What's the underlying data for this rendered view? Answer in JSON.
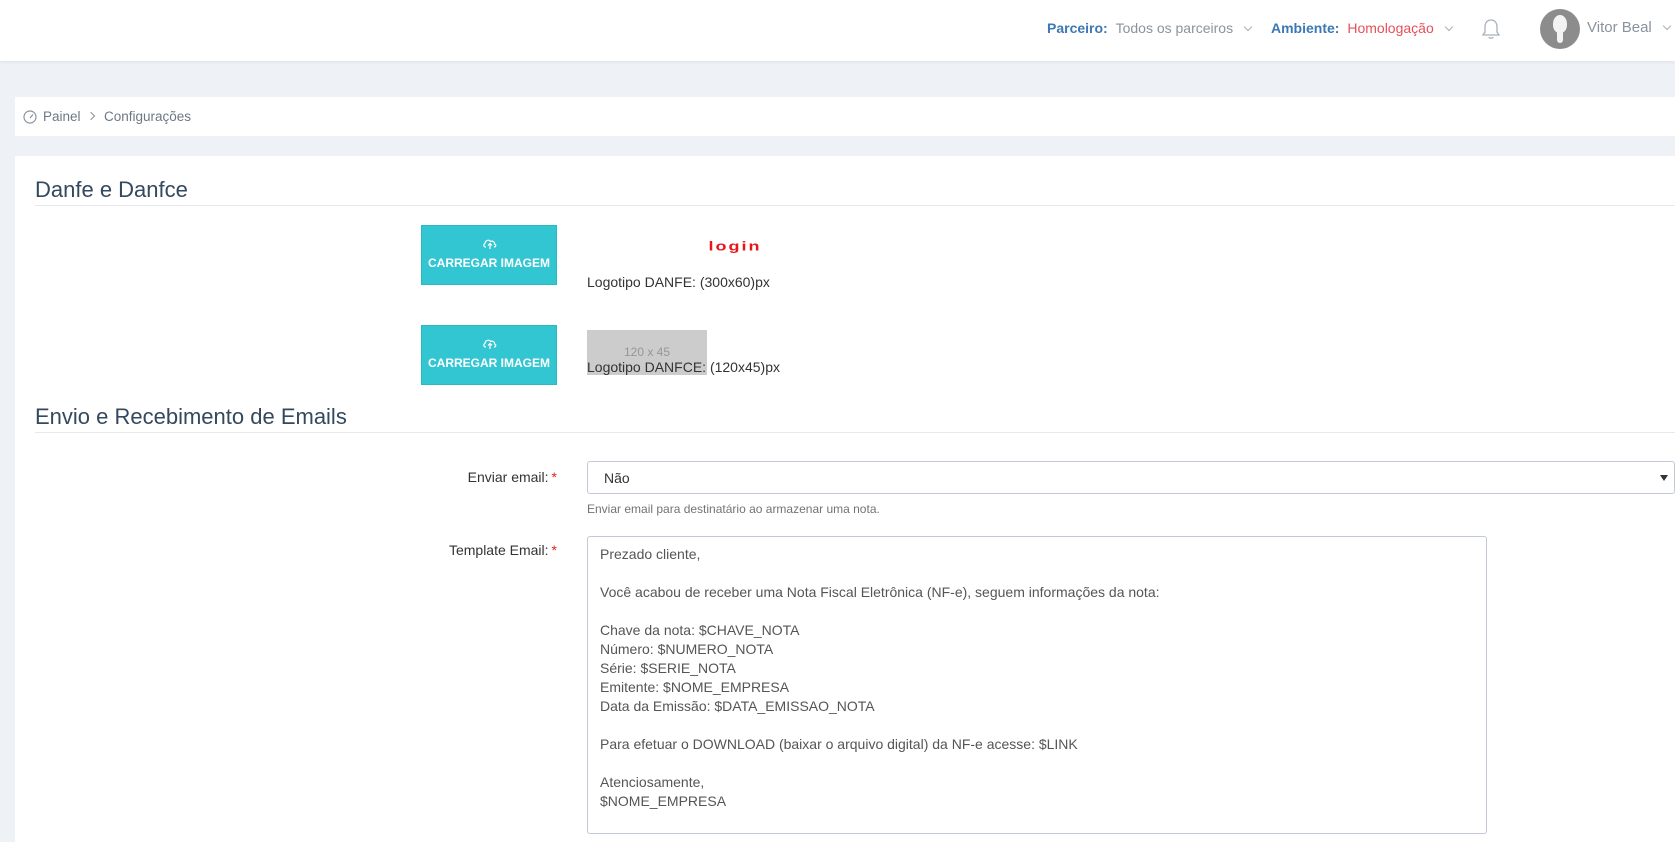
{
  "header": {
    "partner_label": "Parceiro:",
    "partner_value": "Todos os parceiros",
    "env_label": "Ambiente:",
    "env_value": "Homologação",
    "user_name": "Vitor Beal",
    "env_color": "#e7505a",
    "label_color": "#3c78b4"
  },
  "breadcrumb": {
    "items": [
      "Painel",
      "Configurações"
    ]
  },
  "sections": {
    "danfe": {
      "title": "Danfe e Danfce",
      "upload_label": "CARREGAR IMAGEM",
      "logo_text": "login",
      "danfe_caption": "Logotipo DANFE: (300x60)px",
      "danfce_placeholder": "120 x 45",
      "danfce_caption": "Logotipo DANFCE: (120x45)px"
    },
    "email": {
      "title": "Envio e Recebimento de Emails",
      "send_label": "Enviar email:",
      "send_value": "Não",
      "send_help": "Enviar email para destinatário ao armazenar uma nota.",
      "template_label": "Template Email:",
      "template_value": "Prezado cliente,\n\nVocê acabou de receber uma Nota Fiscal Eletrônica (NF-e), seguem informações da nota:\n\nChave da nota: $CHAVE_NOTA\nNúmero: $NUMERO_NOTA\nSérie: $SERIE_NOTA\nEmitente: $NOME_EMPRESA\nData da Emissão: $DATA_EMISSAO_NOTA\n\nPara efetuar o DOWNLOAD (baixar o arquivo digital) da NF-e acesse: $LINK\n\nAtenciosamente,\n$NOME_EMPRESA",
      "required_mark": "*"
    }
  },
  "icons": {
    "bell": "bell-icon",
    "dashboard": "dashboard-icon",
    "upload": "cloud-upload-icon",
    "avatar": "user-avatar"
  },
  "colors": {
    "accent": "#32c5d2",
    "background": "#eef1f5"
  }
}
